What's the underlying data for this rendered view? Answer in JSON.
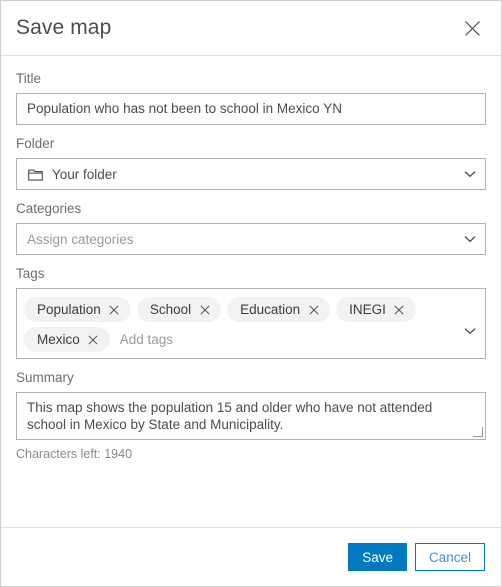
{
  "dialog": {
    "title": "Save map",
    "close_icon": "close-icon"
  },
  "form": {
    "title_field": {
      "label": "Title",
      "value": "Population who has not been to school in Mexico YN",
      "placeholder": "Title"
    },
    "folder_field": {
      "label": "Folder",
      "value": "Your folder",
      "icon": "folder-icon",
      "chevron": "chevron-down-icon"
    },
    "categories_field": {
      "label": "Categories",
      "placeholder": "Assign categories",
      "value": "",
      "chevron": "chevron-down-icon"
    },
    "tags_field": {
      "label": "Tags",
      "placeholder": "Add tags",
      "chevron": "chevron-down-icon",
      "tags": [
        {
          "label": "Population",
          "remove_icon": "close-icon"
        },
        {
          "label": "School",
          "remove_icon": "close-icon"
        },
        {
          "label": "Education",
          "remove_icon": "close-icon"
        },
        {
          "label": "INEGI",
          "remove_icon": "close-icon"
        },
        {
          "label": "Mexico",
          "remove_icon": "close-icon"
        }
      ]
    },
    "summary_field": {
      "label": "Summary",
      "value": "This map shows the population 15 and older who have not attended school in Mexico by State and Municipality.",
      "characters_left": "Characters left: 1940"
    }
  },
  "footer": {
    "save_label": "Save",
    "cancel_label": "Cancel"
  },
  "colors": {
    "accent": "#0079c1",
    "border": "#b3b3b3",
    "chip_bg": "#f2f2f2",
    "label_text": "#6e6e6e",
    "placeholder": "#9a9a9a"
  }
}
